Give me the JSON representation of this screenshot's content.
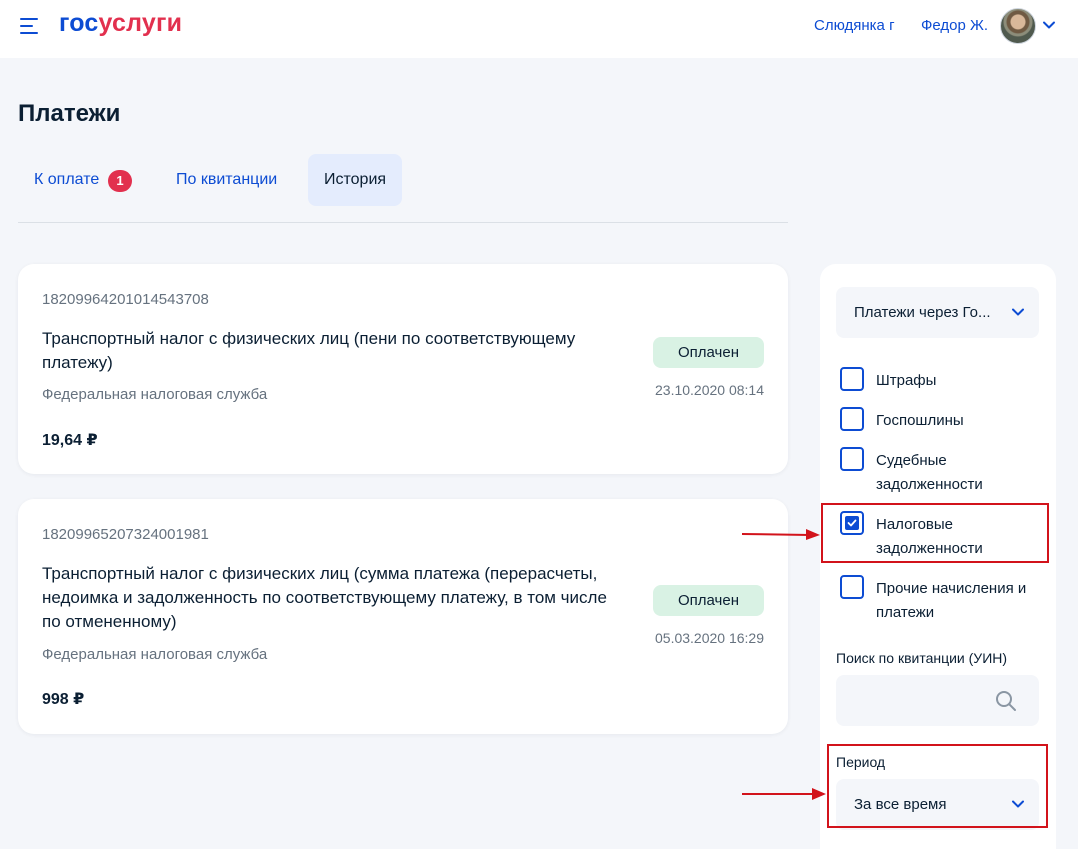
{
  "header": {
    "logo_part1": "гос",
    "logo_part2": "услуги",
    "city": "Слюдянка г",
    "user_name": "Федор Ж.",
    "colors": {
      "brand_blue": "#0d4cd3",
      "brand_red": "#e2304e"
    }
  },
  "page": {
    "title": "Платежи",
    "tabs": [
      {
        "label": "К оплате",
        "badge": "1"
      },
      {
        "label": "По квитанции"
      },
      {
        "label": "История",
        "active": true
      }
    ]
  },
  "payments": [
    {
      "number": "18209964201014543708",
      "title": "Транспортный налог с физических лиц (пени по соответствующему платежу)",
      "org": "Федеральная налоговая служба",
      "amount": "19,64 ₽",
      "status": "Оплачен",
      "date": "23.10.2020 08:14"
    },
    {
      "number": "18209965207324001981",
      "title": "Транспортный налог с физических лиц (сумма платежа (перерасчеты, недоимка и задолженность по соответствующему платежу, в том числе по отмененному)",
      "org": "Федеральная налоговая служба",
      "amount": "998 ₽",
      "status": "Оплачен",
      "date": "05.03.2020 16:29"
    }
  ],
  "filters": {
    "type_select": "Платежи через Го...",
    "checkboxes": [
      {
        "label": "Штрафы",
        "checked": false
      },
      {
        "label": "Госпошлины",
        "checked": false
      },
      {
        "label": "Судебные задолженности",
        "checked": false
      },
      {
        "label": "Налоговые задолженности",
        "checked": true
      },
      {
        "label": "Прочие начисления и платежи",
        "checked": false
      }
    ],
    "search_label": "Поиск по квитанции (УИН)",
    "search_value": "",
    "period_label": "Период",
    "period_value": "За все время"
  },
  "icons": [
    "menu-icon",
    "chevron-down-icon",
    "search-icon",
    "check-icon",
    "arrow-right-icon"
  ],
  "annotation_color": "#d2131b"
}
